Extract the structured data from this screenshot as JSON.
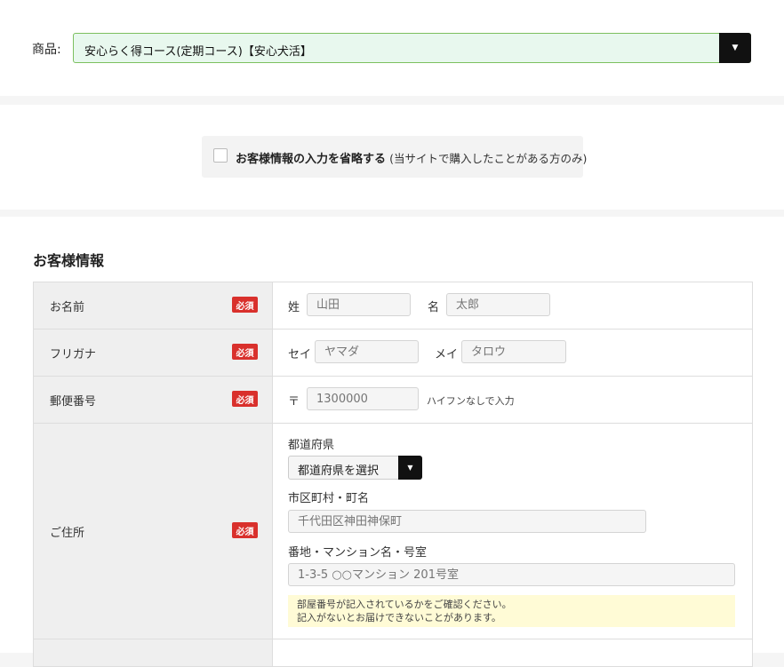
{
  "product": {
    "label": "商品:",
    "selected": "安心らく得コース(定期コース)【安心犬活】",
    "arrow": "▼"
  },
  "skip": {
    "label": "お客様情報の入力を省略する",
    "note": "(当サイトで購入したことがある方のみ)",
    "checked": false
  },
  "customer": {
    "heading": "お客様情報",
    "required_badge": "必須",
    "name": {
      "label": "お名前",
      "last_label": "姓",
      "last_placeholder": "山田",
      "first_label": "名",
      "first_placeholder": "太郎"
    },
    "kana": {
      "label": "フリガナ",
      "last_label": "セイ",
      "last_placeholder": "ヤマダ",
      "first_label": "メイ",
      "first_placeholder": "タロウ"
    },
    "postal": {
      "label": "郵便番号",
      "mark": "〒",
      "placeholder": "1300000",
      "hint": "ハイフンなしで入力"
    },
    "address": {
      "label": "ご住所",
      "pref_label": "都道府県",
      "pref_selected": "都道府県を選択",
      "city_label": "市区町村・町名",
      "city_placeholder": "千代田区神田神保町",
      "street_label": "番地・マンション名・号室",
      "street_placeholder": "1-3-5 ○○マンション 201号室",
      "notice_line1": "部屋番号が記入されているかをご確認ください。",
      "notice_line2": "記入がないとお届けできないことがあります。"
    }
  }
}
